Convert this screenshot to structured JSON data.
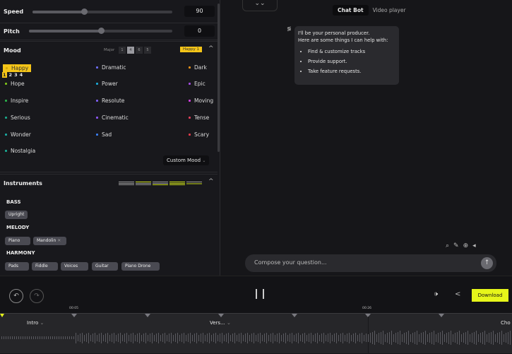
{
  "controls": {
    "speed_label": "Speed",
    "speed_value": "90",
    "speed_fraction": 0.37,
    "pitch_label": "Pitch",
    "pitch_value": "0",
    "pitch_fraction": 0.5
  },
  "mood": {
    "title": "Mood",
    "scale_label": "Major",
    "scale_options": [
      "1",
      "4",
      "6",
      "5"
    ],
    "selected_badge": "Happy 1",
    "variants": [
      "1",
      "2",
      "3",
      "4"
    ],
    "items": [
      {
        "label": "Happy",
        "color": "#f5c518"
      },
      {
        "label": "Dramatic",
        "color": "#6b6bef"
      },
      {
        "label": "Dark",
        "color": "#e8901a"
      },
      {
        "label": "Hope",
        "color": "#7fc31a"
      },
      {
        "label": "Power",
        "color": "#1aa9d6"
      },
      {
        "label": "Epic",
        "color": "#a24be0"
      },
      {
        "label": "Inspire",
        "color": "#2bb04a"
      },
      {
        "label": "Resolute",
        "color": "#7d5ef0"
      },
      {
        "label": "Moving",
        "color": "#d23fe0"
      },
      {
        "label": "Serious",
        "color": "#1aa88a"
      },
      {
        "label": "Cinematic",
        "color": "#8a55f0"
      },
      {
        "label": "Tense",
        "color": "#e0405a"
      },
      {
        "label": "Wonder",
        "color": "#1aa8a0"
      },
      {
        "label": "Sad",
        "color": "#3a7ef0"
      },
      {
        "label": "Scary",
        "color": "#e03a4a"
      },
      {
        "label": "Nostalgia",
        "color": "#1aa890"
      }
    ],
    "custom_mood": "Custom Mood"
  },
  "instruments": {
    "title": "Instruments",
    "groups": [
      {
        "name": "BASS",
        "items": [
          "Upright"
        ]
      },
      {
        "name": "MELODY",
        "items": [
          "Piano",
          "Mandolin"
        ]
      },
      {
        "name": "HARMONY",
        "items": [
          "Pads",
          "Fiddle",
          "Voices",
          "Guitar",
          "Piano Drone"
        ]
      }
    ]
  },
  "chat": {
    "tabs": [
      "Chat Bot",
      "Video player"
    ],
    "intro": "I'll be your personal producer.",
    "intro2": "Here are some things I can help with:",
    "bullets": [
      "Find & customize tracks",
      "Provide support.",
      "Take feature requests."
    ],
    "placeholder": "Compose your question..."
  },
  "player": {
    "download": "Download",
    "time_markers": [
      "00:05",
      "00:26"
    ],
    "sections": [
      "Intro",
      "Vers...",
      "Cho"
    ]
  },
  "colors": {
    "accent": "#e6f51a",
    "badge": "#f5c518"
  }
}
